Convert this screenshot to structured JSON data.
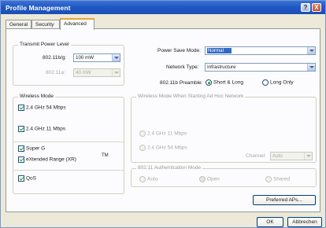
{
  "window": {
    "title": "Profile Management"
  },
  "titlebar_buttons": {
    "help": "?",
    "close": "X"
  },
  "tabs": [
    "General",
    "Security",
    "Advanced"
  ],
  "transmit_power": {
    "title": "Transmit Power Level",
    "bg_label": "802.11b/g:",
    "bg_value": "100 mW",
    "a_label": "802.11a:",
    "a_value": "40 mW"
  },
  "right_settings": {
    "power_save_label": "Power Save Mode:",
    "power_save_value": "Normal",
    "network_type_label": "Network Type:",
    "network_type_value": "Infrastructure",
    "preamble_label": "802.11b Preamble:",
    "preamble_short_long": "Short & Long",
    "preamble_long_only": "Long Only"
  },
  "wireless_mode": {
    "title": "Wireless Mode",
    "items": [
      "2.4 GHz 54 Mbps",
      "2.4 GHz 11 Mbps",
      "Super G",
      "eXtended Range (XR)"
    ],
    "tm": "TM",
    "qos": "QoS"
  },
  "adhoc": {
    "title": "Wireless Mode When Starting Ad Hoc Network",
    "opt_11": "2.4 GHz 11 Mbps",
    "opt_54": "2.4 GHz 54 Mbps",
    "channel_label": "Channel:",
    "channel_value": "Auto"
  },
  "auth": {
    "title": "802.11 Authentication Mode",
    "auto": "Auto",
    "open": "Open",
    "shared": "Shared"
  },
  "buttons": {
    "preferred_aps": "Preferred APs...",
    "ok": "OK",
    "cancel": "Abbrechen"
  }
}
